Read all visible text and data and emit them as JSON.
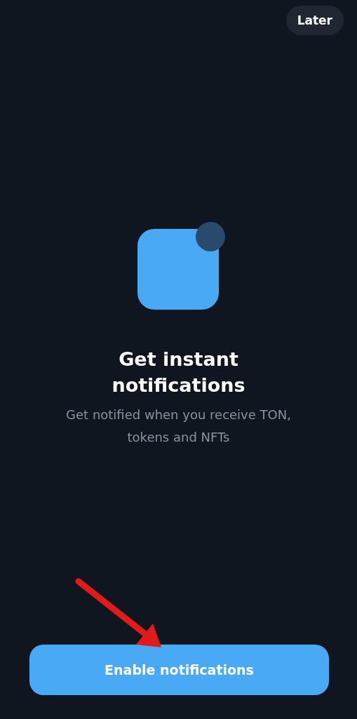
{
  "top_bar": {
    "skip_button": "Later"
  },
  "content": {
    "title": "Get instant notifications",
    "subtitle": "Get notified when you receive TON, tokens and NFTs"
  },
  "primary_button": "Enable notifications"
}
